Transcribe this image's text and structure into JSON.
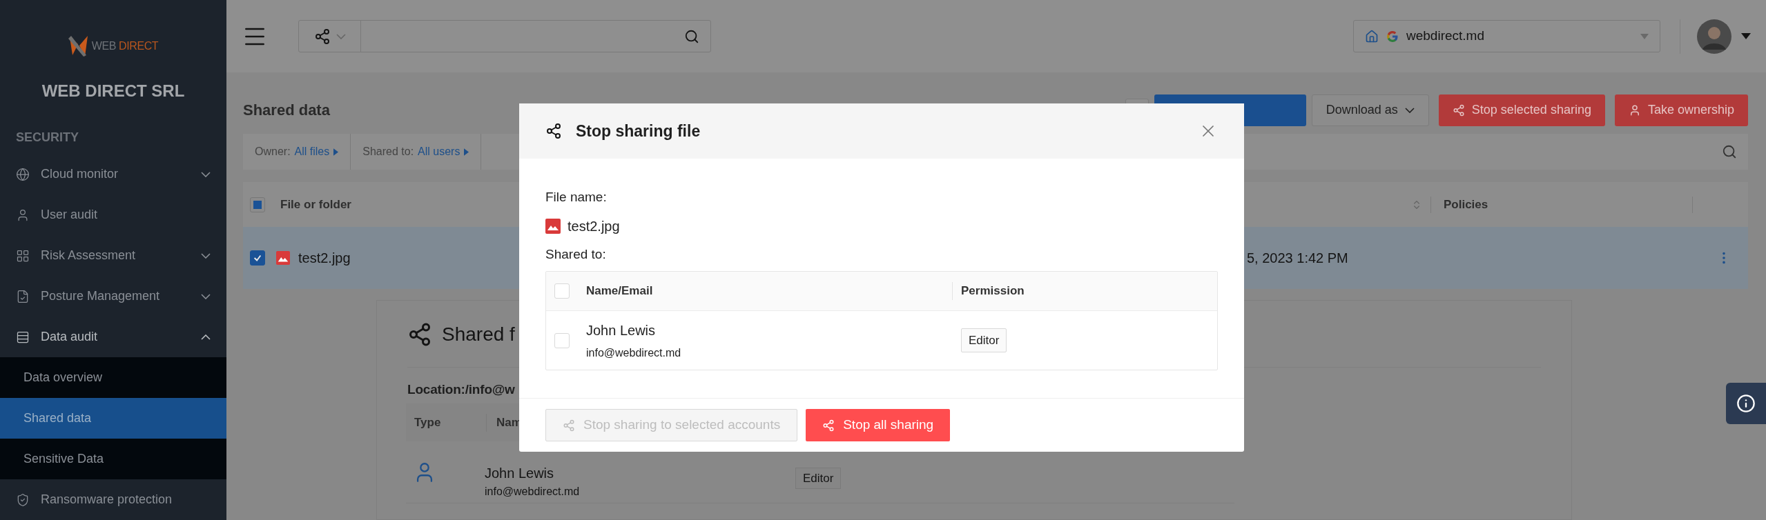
{
  "sidebar": {
    "logo": {
      "word_1": "WEB",
      "word_2": "DIRECT"
    },
    "org_name": "WEB DIRECT SRL",
    "section": "SECURITY",
    "items": [
      {
        "label": "Cloud monitor",
        "expanded": false
      },
      {
        "label": "User audit"
      },
      {
        "label": "Risk Assessment",
        "expanded": false
      },
      {
        "label": "Posture Management",
        "expanded": false
      },
      {
        "label": "Data audit",
        "expanded": true,
        "children": [
          {
            "label": "Data overview",
            "selected": false
          },
          {
            "label": "Shared data",
            "selected": true
          },
          {
            "label": "Sensitive Data",
            "selected": false
          }
        ]
      },
      {
        "label": "Ransomware protection"
      }
    ]
  },
  "topbar": {
    "domain_select": {
      "value": "webdirect.md"
    }
  },
  "page": {
    "title": "Shared data",
    "actions": [
      {
        "label": "Download as",
        "kind": "dropdown"
      },
      {
        "label": "Stop selected sharing",
        "kind": "share"
      },
      {
        "label": "Take ownership",
        "kind": "user"
      }
    ],
    "filters": [
      {
        "label": "Owner:",
        "value": "All files"
      },
      {
        "label": "Shared to:",
        "value": "All users"
      }
    ],
    "table": {
      "header_checkbox": {
        "checked": false,
        "indeterminate": true
      },
      "columns": [
        "File or folder",
        "Policies"
      ],
      "rows": [
        {
          "name": "test2.jpg",
          "checked": true,
          "date": "5, 2023 1:42 PM"
        }
      ]
    },
    "detail": {
      "title": "Shared f",
      "location": "Location:/info@w",
      "columns": [
        "Type",
        "Nam"
      ],
      "rows": [
        {
          "name": "John Lewis",
          "email": "info@webdirect.md",
          "permission": "Editor"
        }
      ]
    }
  },
  "modal": {
    "title": "Stop sharing file",
    "file_label": "File name:",
    "file_name": "test2.jpg",
    "shared_label": "Shared to:",
    "columns": [
      "Name/Email",
      "Permission"
    ],
    "header_checked": false,
    "rows": [
      {
        "checked": false,
        "name": "John Lewis",
        "email": "info@webdirect.md",
        "permission": "Editor"
      }
    ],
    "buttons": [
      {
        "label": "Stop sharing to selected accounts",
        "disabled": true
      },
      {
        "label": "Stop all sharing",
        "disabled": false
      }
    ]
  }
}
